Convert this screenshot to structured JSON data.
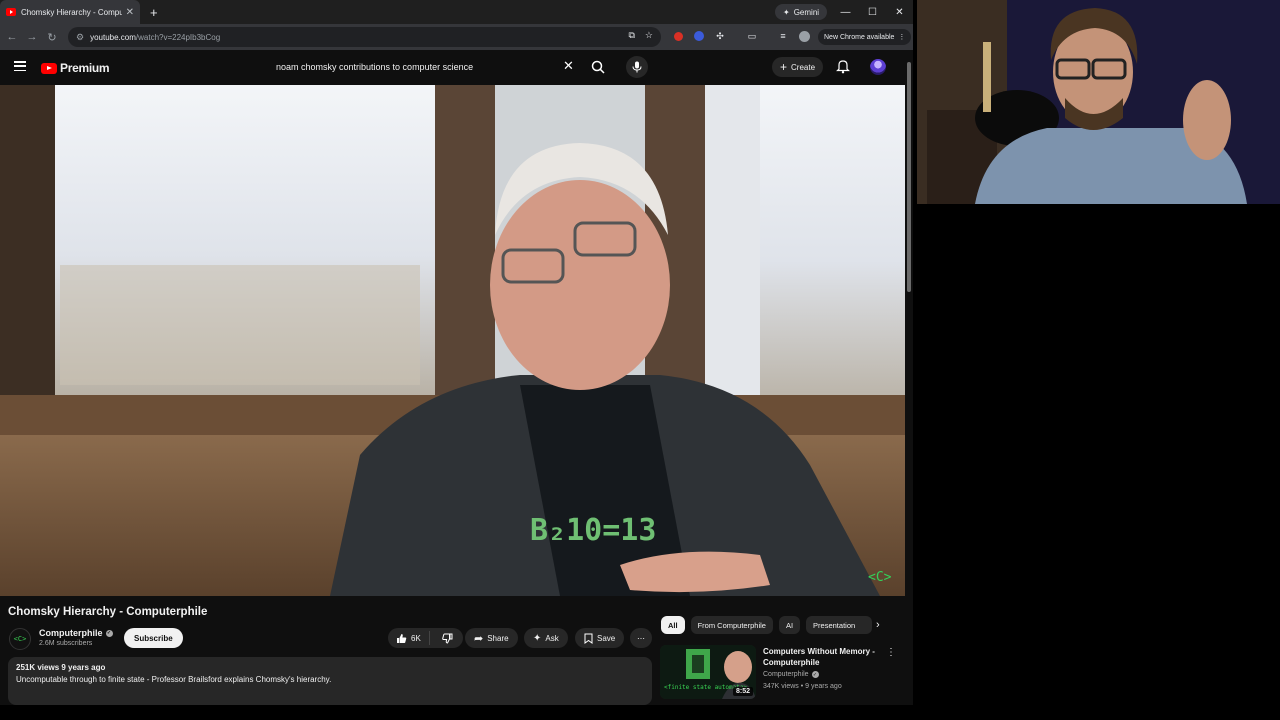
{
  "browser": {
    "tab_title": "Chomsky Hierarchy - Computerphile",
    "new_tab": "+",
    "gemini_label": "Gemini",
    "url_host": "youtube.com",
    "url_path": "/watch?v=224pIb3bCog",
    "new_chrome_label": "New Chrome available"
  },
  "youtube": {
    "logo_text": "Premium",
    "search_query": "noam chomsky contributions to computer science",
    "create_label": "Create"
  },
  "video": {
    "title": "Chomsky Hierarchy - Computerphile",
    "watermark": "<C>"
  },
  "channel": {
    "name": "Computerphile",
    "subscribers": "2.6M subscribers",
    "avatar_text": "<C>",
    "subscribe_label": "Subscribe"
  },
  "actions": {
    "likes": "6K",
    "share": "Share",
    "ask": "Ask",
    "save": "Save"
  },
  "description": {
    "meta": "251K views  9 years ago",
    "text": "Uncomputable through to finite state - Professor Brailsford explains Chomsky's hierarchy."
  },
  "chips": [
    "All",
    "From Computerphile",
    "AI",
    "Presentation"
  ],
  "recommendation": {
    "title": "Computers Without Memory - Computerphile",
    "channel": "Computerphile",
    "meta": "347K views • 9 years ago",
    "duration": "8:52",
    "thumb_text": "<finite state automata>"
  }
}
